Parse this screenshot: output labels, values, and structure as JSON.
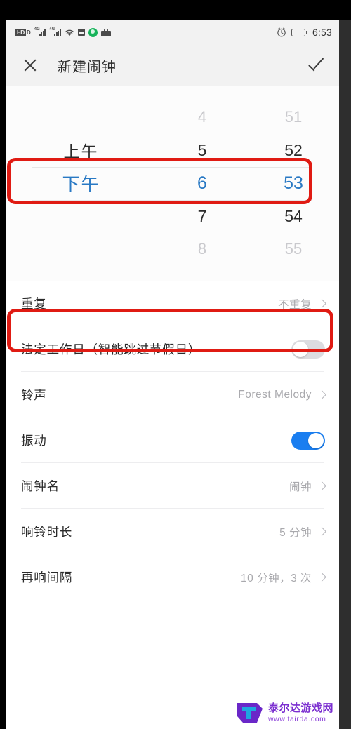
{
  "statusbar": {
    "network_badge": "HD",
    "data_badge": "D",
    "signal_label_1": "4G",
    "signal_label_2": "4G",
    "icons": [
      "hd-badge-icon",
      "signal-4g-icon",
      "signal-4g-icon",
      "wifi-icon",
      "sdcard-icon",
      "app-green-icon",
      "work-profile-icon",
      "alarm-icon",
      "battery-icon"
    ],
    "clock": "6:53"
  },
  "titlebar": {
    "close_label": "X",
    "title": "新建闹钟",
    "confirm_label": "✓"
  },
  "picker": {
    "columns": [
      "ampm",
      "hour",
      "minute"
    ],
    "rows": [
      {
        "ampm": "",
        "hour": "4",
        "minute": "51",
        "state": "far"
      },
      {
        "ampm": "上午",
        "hour": "5",
        "minute": "52",
        "state": "near"
      },
      {
        "ampm": "下午",
        "hour": "6",
        "minute": "53",
        "state": "selected"
      },
      {
        "ampm": "",
        "hour": "7",
        "minute": "54",
        "state": "near"
      },
      {
        "ampm": "",
        "hour": "8",
        "minute": "55",
        "state": "far"
      }
    ],
    "selected": {
      "ampm": "下午",
      "hour": "6",
      "minute": "53"
    },
    "accent_color": "#2979c4"
  },
  "settings": [
    {
      "label": "重复",
      "value": "不重复",
      "control": "chevron",
      "highlighted": true
    },
    {
      "label": "法定工作日（智能跳过节假日）",
      "value": "",
      "control": "toggle",
      "toggle_state": "off"
    },
    {
      "label": "铃声",
      "value": "Forest Melody",
      "control": "chevron"
    },
    {
      "label": "振动",
      "value": "",
      "control": "toggle",
      "toggle_state": "on"
    },
    {
      "label": "闹钟名",
      "value": "闹钟",
      "control": "chevron"
    },
    {
      "label": "响铃时长",
      "value": "5 分钟",
      "control": "chevron"
    },
    {
      "label": "再响间隔",
      "value": "10 分钟，3 次",
      "control": "chevron"
    }
  ],
  "annotations": {
    "color": "#e01b13",
    "boxes": [
      "selected-time-row",
      "repeat-row"
    ]
  },
  "watermark": {
    "site_name": "泰尔达游戏网",
    "url": "www.tairda.com"
  },
  "theme": {
    "toggle_on_color": "#1a7ef0",
    "toggle_off_color": "#dcdce0",
    "statusbar_bg": "#f2f2f2",
    "list_bg": "#ffffff"
  }
}
